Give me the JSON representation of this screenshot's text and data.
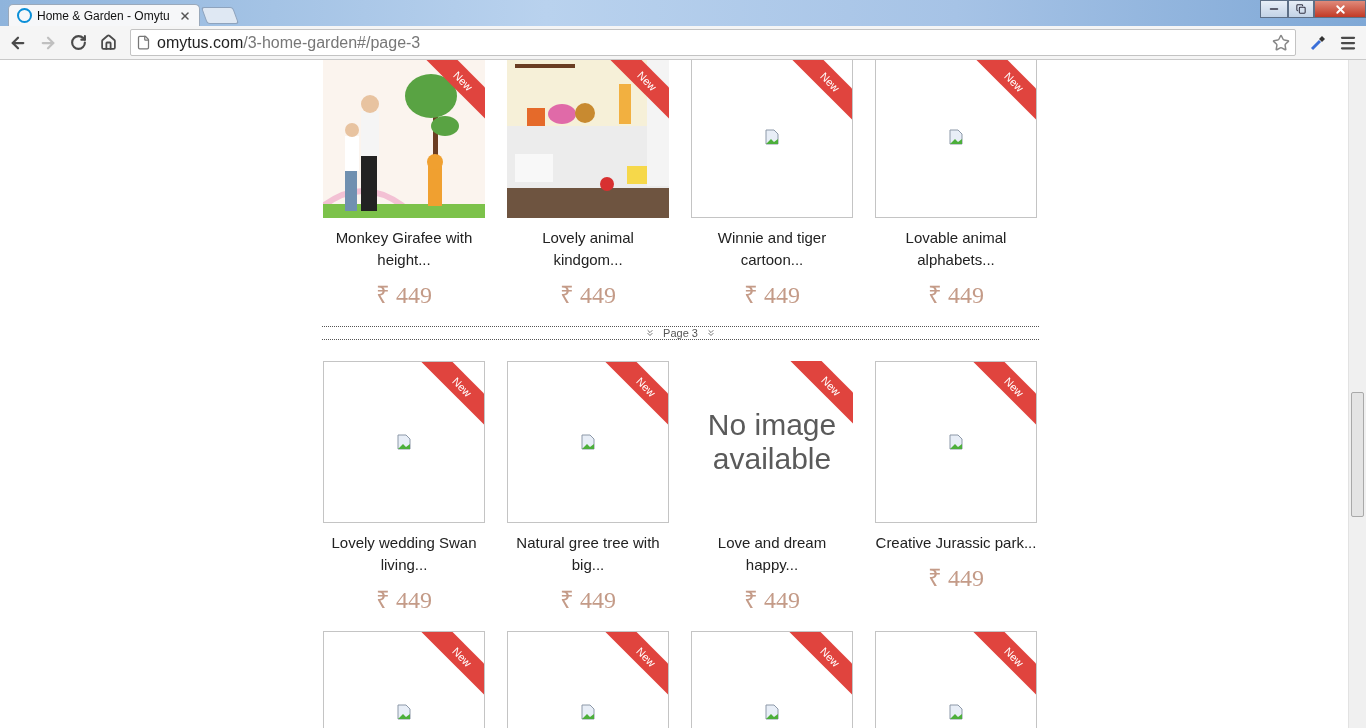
{
  "browser": {
    "tab_title": "Home & Garden - Omytu",
    "url_domain": "omytus.com",
    "url_path": "/3-home-garden#/page-3",
    "forward_disabled": true
  },
  "blocks": [
    {
      "kind": "products",
      "items": [
        {
          "kind": "picture",
          "badge": "New",
          "name_lines": [
            "Monkey Girafee with",
            "height..."
          ],
          "price": "₹ 449"
        },
        {
          "kind": "picture",
          "badge": "New",
          "name_lines": [
            "Lovely animal",
            "kindgom..."
          ],
          "price": "₹ 449"
        },
        {
          "kind": "broken",
          "badge": "New",
          "name_lines": [
            "Winnie and tiger",
            "cartoon..."
          ],
          "price": "₹ 449"
        },
        {
          "kind": "broken",
          "badge": "New",
          "name_lines": [
            "Lovable animal",
            "alphabets..."
          ],
          "price": "₹ 449"
        }
      ]
    },
    {
      "kind": "page_divider",
      "label": "Page 3"
    },
    {
      "kind": "products",
      "items": [
        {
          "kind": "broken",
          "badge": "New",
          "name_lines": [
            "Lovely wedding Swan",
            "living..."
          ],
          "price": "₹ 449"
        },
        {
          "kind": "broken",
          "badge": "New",
          "name_lines": [
            "Natural gree tree with",
            "big..."
          ],
          "price": "₹ 449"
        },
        {
          "kind": "placeholder",
          "no_image_lines": [
            "No image",
            "available"
          ],
          "badge": "New",
          "name_lines": [
            "Love and dream",
            "happy..."
          ],
          "price": "₹ 449"
        },
        {
          "kind": "broken",
          "badge": "New",
          "name_lines": [
            "Creative Jurassic park..."
          ],
          "price": "₹ 449"
        }
      ]
    },
    {
      "kind": "products",
      "items": [
        {
          "kind": "broken",
          "badge": "New"
        },
        {
          "kind": "broken",
          "badge": "New"
        },
        {
          "kind": "broken",
          "badge": "New"
        },
        {
          "kind": "broken",
          "badge": "New"
        }
      ]
    }
  ]
}
